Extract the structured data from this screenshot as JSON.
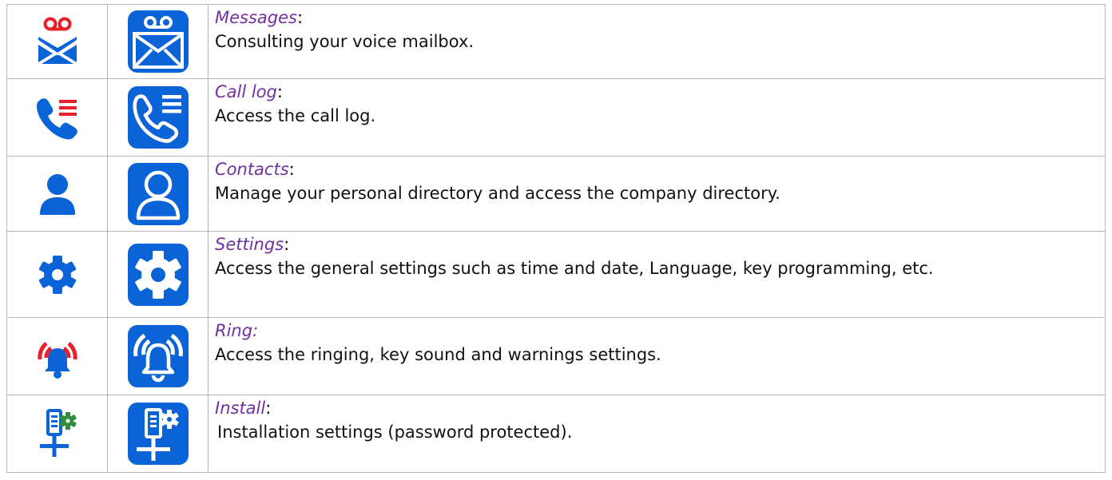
{
  "rows": [
    {
      "icon_small": "voicemail-envelope-icon",
      "icon_large": "voicemail-envelope-key-icon",
      "name": "Messages",
      "colon": ":",
      "description": "Consulting your voice mailbox."
    },
    {
      "icon_small": "call-log-icon",
      "icon_large": "call-log-key-icon",
      "name": "Call log",
      "colon": ":",
      "description": "Access the call log."
    },
    {
      "icon_small": "contact-person-icon",
      "icon_large": "contact-person-key-icon",
      "name": "Contacts",
      "colon": ":",
      "description": "Manage your personal directory and access the company directory."
    },
    {
      "icon_small": "gear-icon",
      "icon_large": "gear-key-icon",
      "name": "Settings",
      "colon": ":",
      "description": "Access the general settings such as time and date, Language, key programming, etc."
    },
    {
      "icon_small": "ringing-bell-icon",
      "icon_large": "ringing-bell-key-icon",
      "name": "Ring:",
      "colon": "",
      "description": "Access the ringing, key sound and warnings settings."
    },
    {
      "icon_small": "install-network-icon",
      "icon_large": "install-network-key-icon",
      "name": "Install",
      "colon": ":",
      "description": "Installation settings (password protected)."
    }
  ],
  "colors": {
    "icon_blue": "#0b63d8",
    "accent_red": "#e8202a",
    "accent_green": "#2f8f3a",
    "name_purple": "#7030a0",
    "border": "#b5b5b5"
  }
}
